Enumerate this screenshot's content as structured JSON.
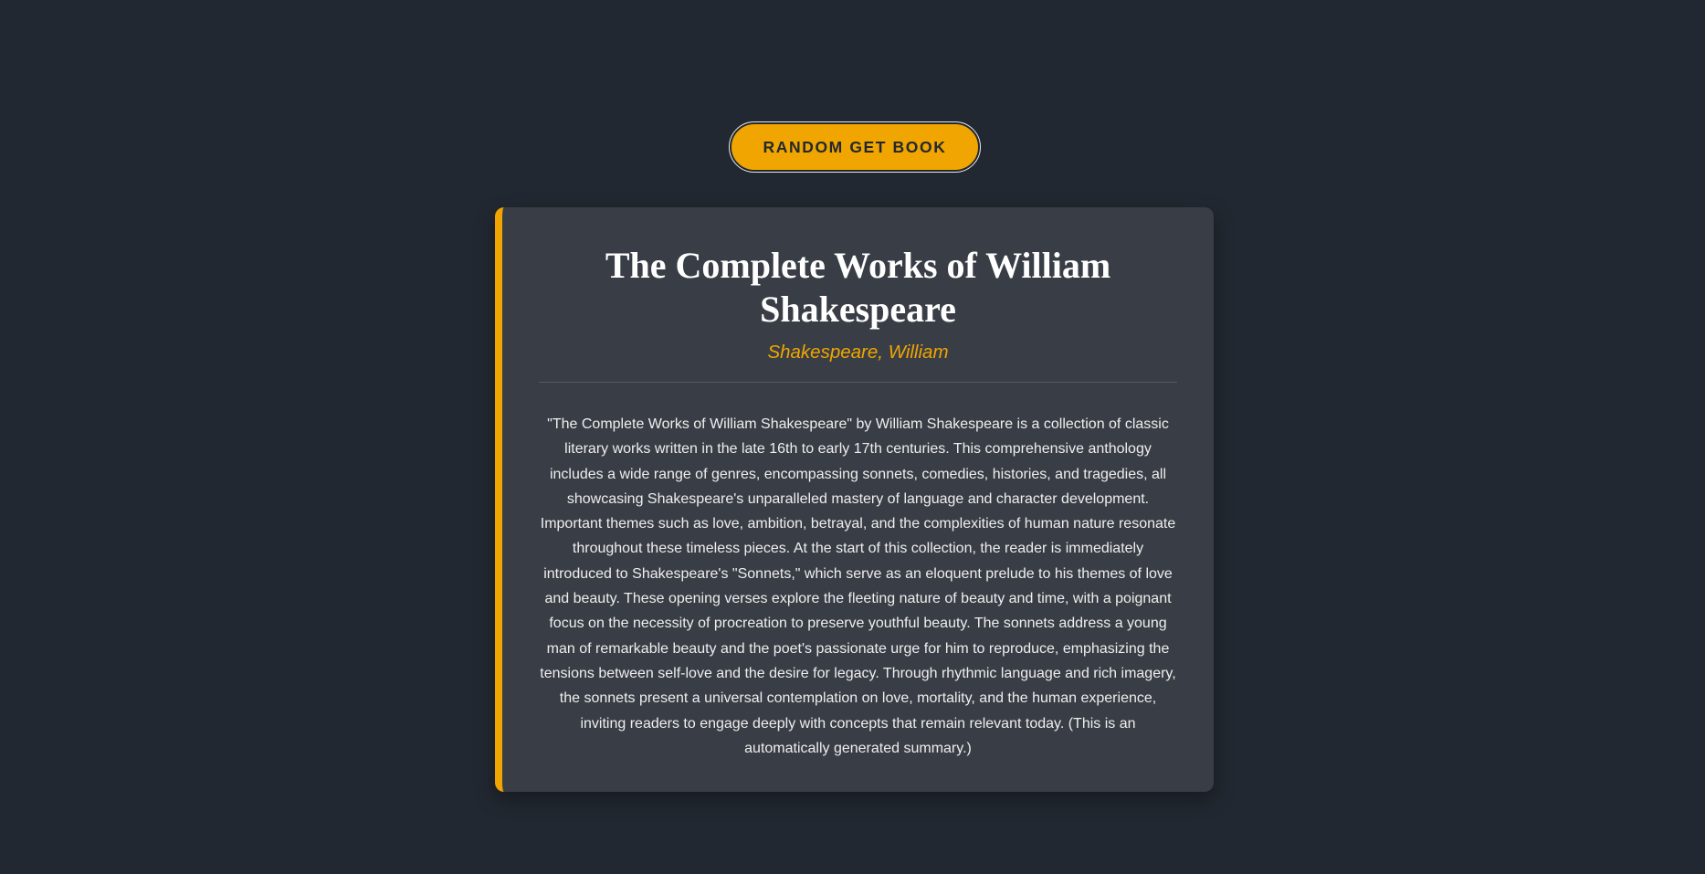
{
  "controls": {
    "random_button_label": "RANDOM GET BOOK"
  },
  "book": {
    "title": "The Complete Works of William Shakespeare",
    "author": "Shakespeare, William",
    "summary": "\"The Complete Works of William Shakespeare\" by William Shakespeare is a collection of classic literary works written in the late 16th to early 17th centuries. This comprehensive anthology includes a wide range of genres, encompassing sonnets, comedies, histories, and tragedies, all showcasing Shakespeare's unparalleled mastery of language and character development. Important themes such as love, ambition, betrayal, and the complexities of human nature resonate throughout these timeless pieces. At the start of this collection, the reader is immediately introduced to Shakespeare's \"Sonnets,\" which serve as an eloquent prelude to his themes of love and beauty. These opening verses explore the fleeting nature of beauty and time, with a poignant focus on the necessity of procreation to preserve youthful beauty. The sonnets address a young man of remarkable beauty and the poet's passionate urge for him to reproduce, emphasizing the tensions between self-love and the desire for legacy. Through rhythmic language and rich imagery, the sonnets present a universal contemplation on love, mortality, and the human experience, inviting readers to engage deeply with concepts that remain relevant today. (This is an automatically generated summary.)"
  },
  "colors": {
    "background": "#222831",
    "card": "#393e46",
    "accent": "#f0a500",
    "title_text": "#ffffff",
    "body_text": "#eeeeee"
  }
}
